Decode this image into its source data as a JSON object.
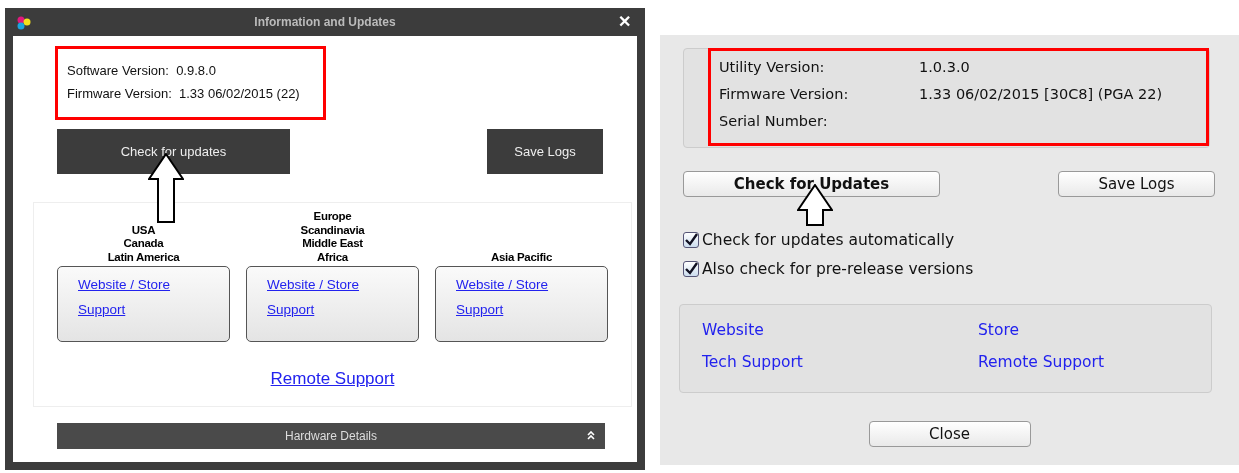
{
  "left_window": {
    "title": "Information and Updates",
    "close_glyph": "✕",
    "info": [
      {
        "label": "Software Version:",
        "value": "0.9.8.0"
      },
      {
        "label": "Firmware Version:",
        "value": "1.33 06/02/2015  (22)"
      }
    ],
    "buttons": [
      "Check for updates",
      "Save Logs"
    ],
    "regions": [
      {
        "lines": [
          "USA",
          "Canada",
          "Latin America"
        ],
        "links": [
          "Website / Store",
          "Support"
        ]
      },
      {
        "lines": [
          "Europe",
          "Scandinavia",
          "Middle East",
          "Africa"
        ],
        "links": [
          "Website / Store",
          "Support"
        ]
      },
      {
        "lines": [
          "Asia Pacific"
        ],
        "links": [
          "Website / Store",
          "Support"
        ]
      }
    ],
    "remote_link": "Remote Support",
    "footer": "Hardware Details"
  },
  "right_window": {
    "info": [
      {
        "label": "Utility Version:",
        "value": "1.0.3.0"
      },
      {
        "label": "Firmware Version:",
        "value": "1.33 06/02/2015  [30C8] (PGA 22)"
      },
      {
        "label": "Serial Number:"
      }
    ],
    "buttons": [
      "Check for Updates",
      "Save Logs"
    ],
    "checkboxes": [
      {
        "label": "Check for updates automatically",
        "checked": true
      },
      {
        "label": "Also check for pre-release versions",
        "checked": true
      }
    ],
    "links": [
      "Website",
      "Store",
      "Tech Support",
      "Remote Support"
    ],
    "close": "Close"
  }
}
